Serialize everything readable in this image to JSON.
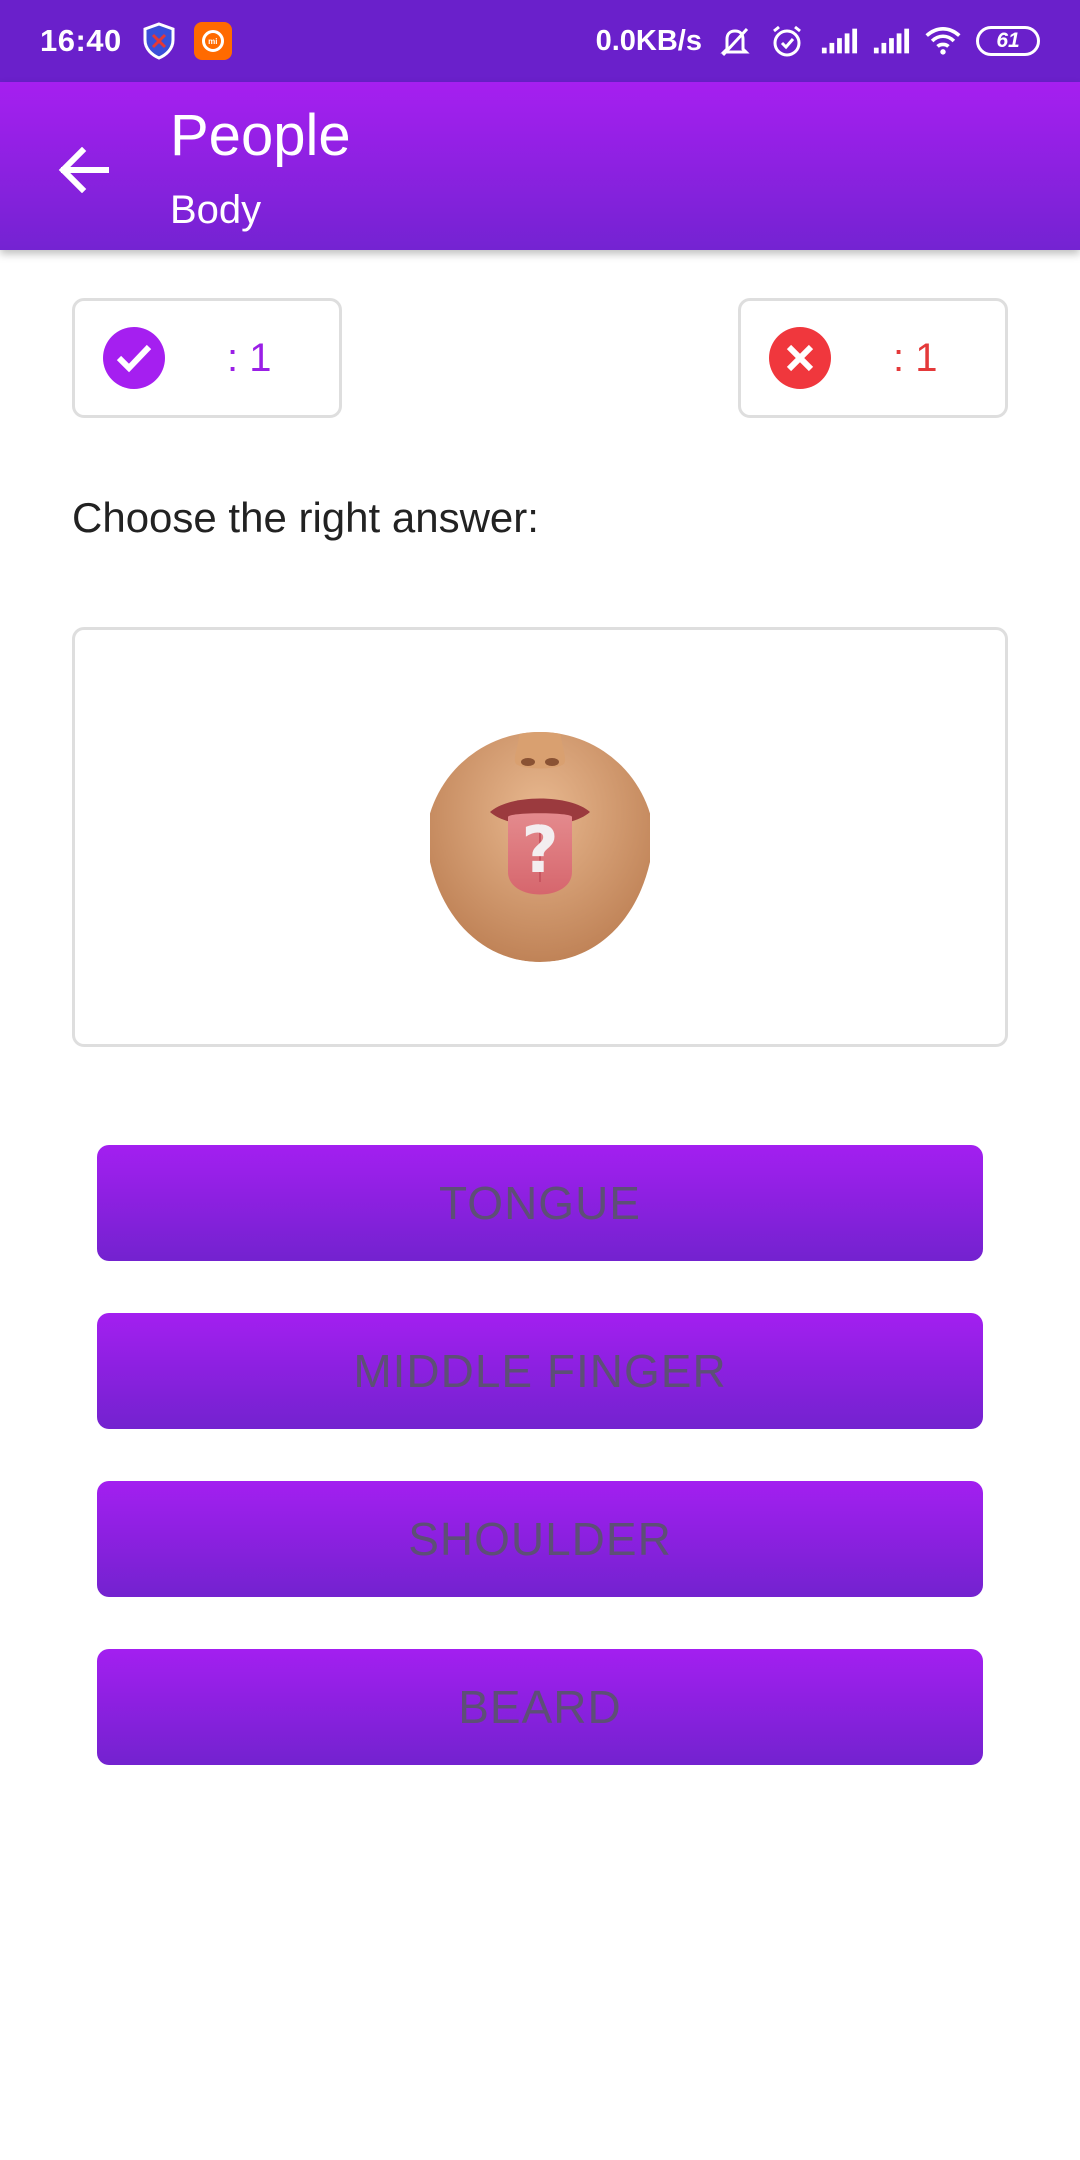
{
  "status_bar": {
    "time": "16:40",
    "network_speed": "0.0KB/s",
    "battery_level": "61",
    "icons": [
      "shield-icon",
      "mi-app-icon",
      "mute-icon",
      "alarm-icon",
      "signal-icon",
      "signal-icon",
      "wifi-icon",
      "battery-icon"
    ]
  },
  "app_bar": {
    "title": "People",
    "subtitle": "Body",
    "back_icon": "arrow-back-icon"
  },
  "score": {
    "correct": ": 1",
    "wrong": ": 1",
    "correct_color": "#a51ff0",
    "wrong_color": "#f0373d"
  },
  "question": {
    "prompt": "Choose the right answer:",
    "image_icon": "face-tongue-question-image"
  },
  "answers": [
    {
      "label": "TONGUE"
    },
    {
      "label": "MIDDLE FINGER"
    },
    {
      "label": "SHOULDER"
    },
    {
      "label": "BEARD"
    }
  ],
  "colors": {
    "status_bar": "#6a20cb",
    "accent_top": "#a61ff0",
    "accent_bottom": "#7423d2"
  }
}
